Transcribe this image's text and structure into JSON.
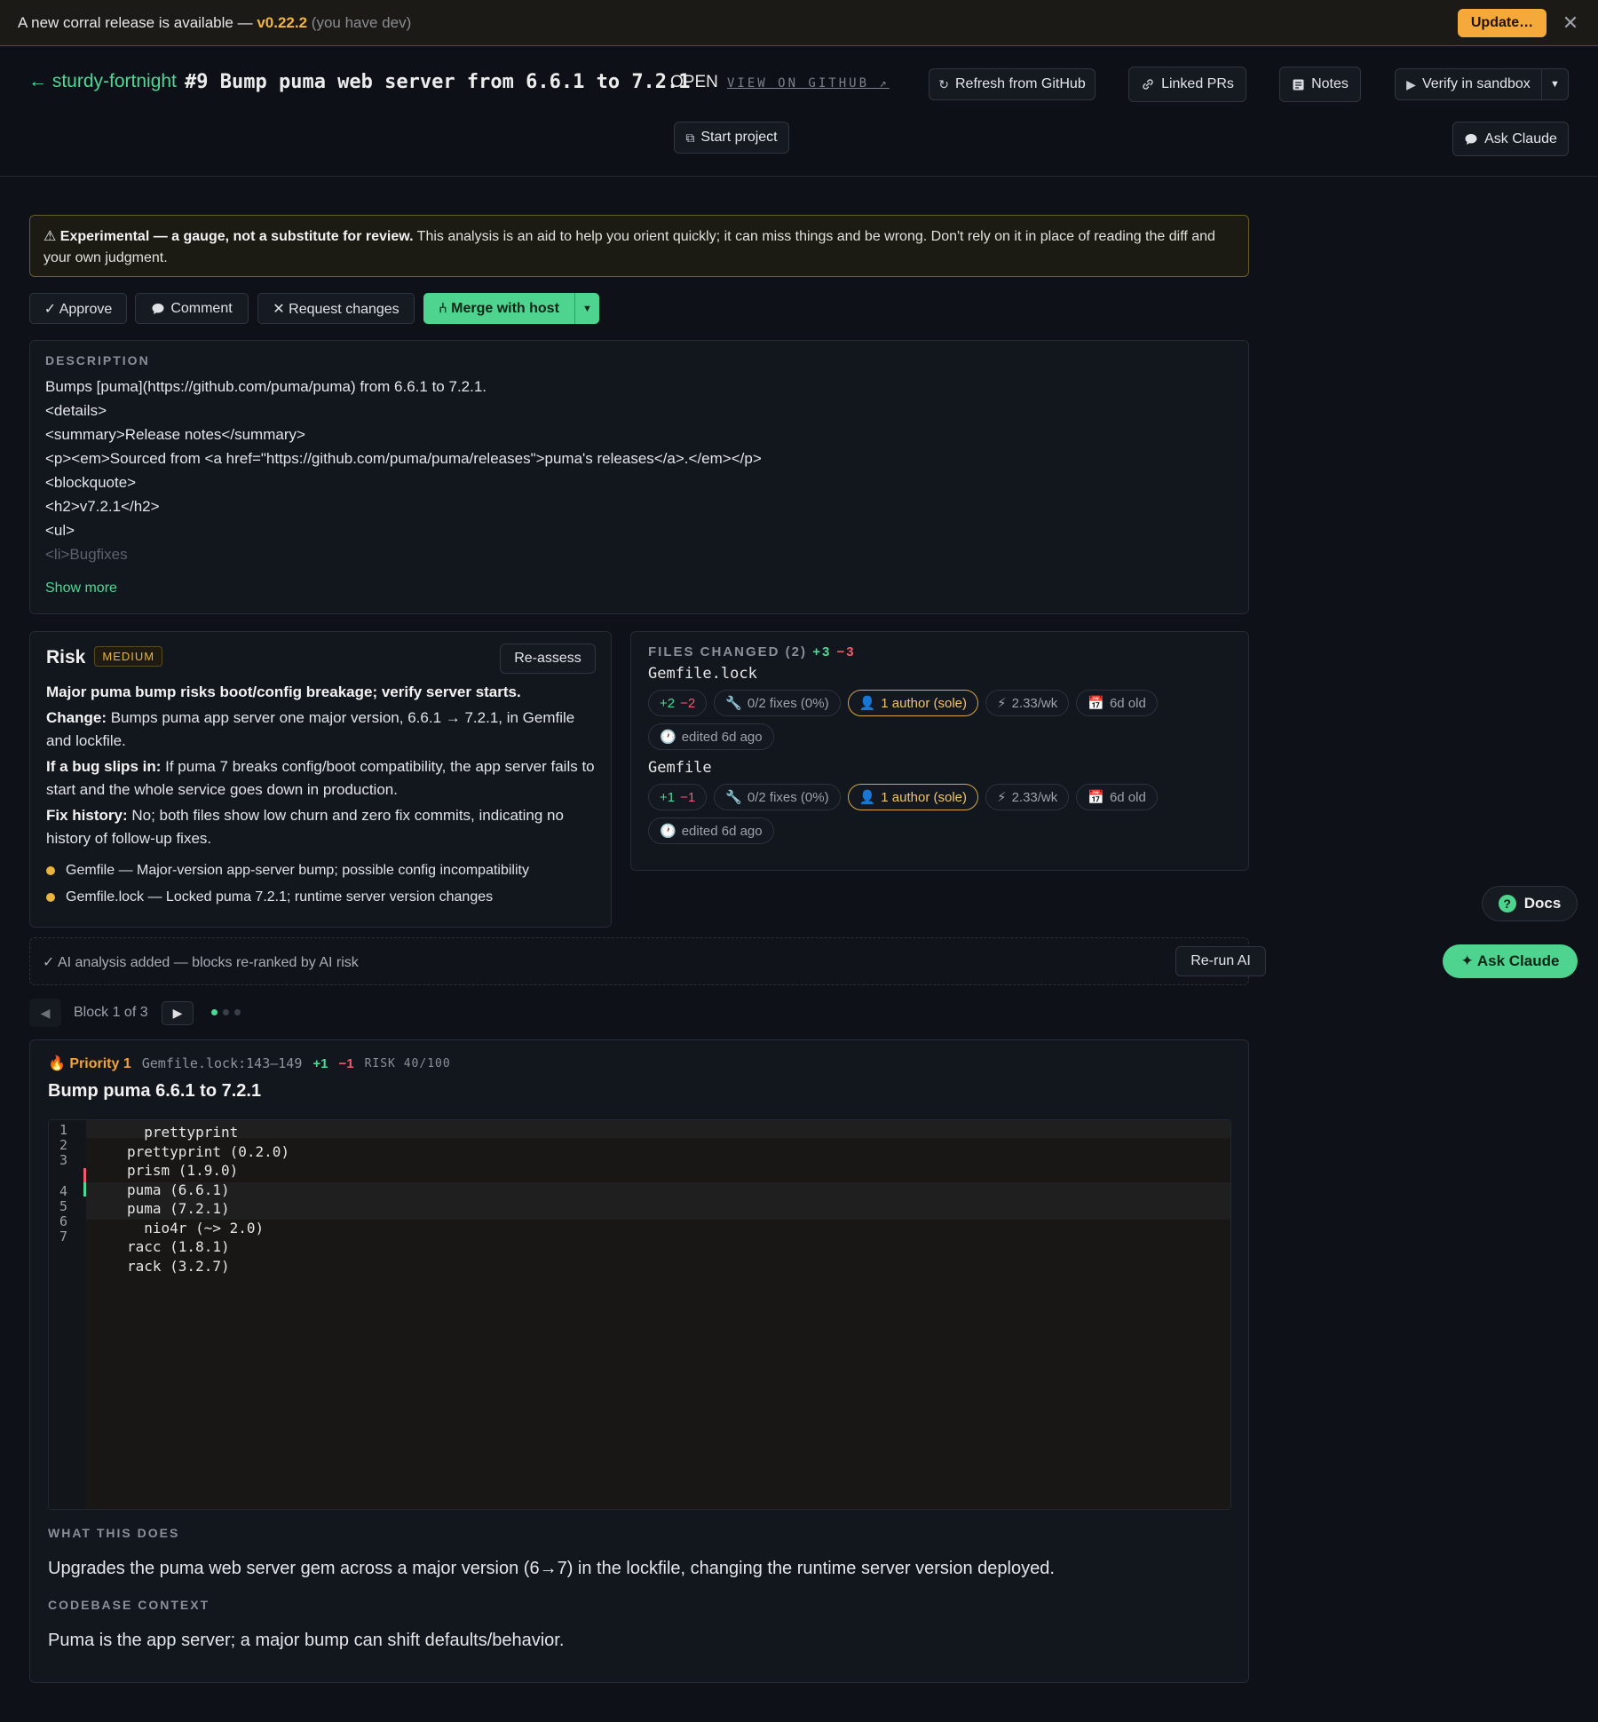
{
  "banner": {
    "message": "A new corral release is available —",
    "version": "v0.22.2",
    "have": "(you have dev)",
    "update_label": "Update…",
    "close_glyph": "✕"
  },
  "header": {
    "back_label": "← sturdy-fortnight",
    "pr_title": "#9 Bump puma web server from 6.6.1 to 7.2.1",
    "state": "OPEN",
    "view_on_github": "VIEW ON GITHUB ↗",
    "refresh_label": "Refresh from GitHub",
    "linked_prs_label": "Linked PRs",
    "notes_label": "Notes",
    "verify_label": "Verify in sandbox",
    "start_project_label": "Start project",
    "ask_claude_label": "Ask Claude"
  },
  "warning": {
    "bold": "⚠ Experimental — a gauge, not a substitute for review.",
    "text": " This analysis is an aid to help you orient quickly; it can miss things and be wrong. Don't rely on it in place of reading the diff and your own judgment."
  },
  "actions": {
    "approve": "✓ Approve",
    "comment": "Comment",
    "request_changes": "✕ Request changes",
    "merge": "⑃ Merge with host"
  },
  "description": {
    "label": "DESCRIPTION",
    "lines": [
      "Bumps [puma](https://github.com/puma/puma) from 6.6.1 to 7.2.1.",
      "<details>",
      "<summary>Release notes</summary>",
      "<p><em>Sourced from <a href=\"https://github.com/puma/puma/releases\">puma's releases</a>.</em></p>",
      "<blockquote>",
      "<h2>v7.2.1</h2>",
      "<ul>",
      "<li>Bugfixes"
    ],
    "show_more": "Show more"
  },
  "risk": {
    "title": "Risk",
    "level": "MEDIUM",
    "reassess_label": "Re-assess",
    "headline": "Major puma bump risks boot/config breakage; verify server starts.",
    "change_label": "Change:",
    "change_text": " Bumps puma app server one major version, 6.6.1 → 7.2.1, in Gemfile and lockfile.",
    "bug_label": "If a bug slips in:",
    "bug_text": " If puma 7 breaks config/boot compatibility, the app server fails to start and the whole service goes down in production.",
    "fix_label": "Fix history:",
    "fix_text": " No; both files show low churn and zero fix commits, indicating no history of follow-up fixes.",
    "items": [
      "Gemfile — Major-version app-server bump; possible config incompatibility",
      "Gemfile.lock — Locked puma 7.2.1; runtime server version changes"
    ],
    "accent_color": "#e8b43d"
  },
  "files": {
    "label": "FILES CHANGED (2)",
    "add_total": "+3",
    "del_total": "−3",
    "list": [
      {
        "name": "Gemfile.lock",
        "add": "+2",
        "del": "−2",
        "fixes": "0/2 fixes (0%)",
        "author": "1 author (sole)",
        "rate": "2.33/wk",
        "age": "6d old",
        "edited": "edited 6d ago"
      },
      {
        "name": "Gemfile",
        "add": "+1",
        "del": "−1",
        "fixes": "0/2 fixes (0%)",
        "author": "1 author (sole)",
        "rate": "2.33/wk",
        "age": "6d old",
        "edited": "edited 6d ago"
      }
    ]
  },
  "ai": {
    "status": "✓ AI analysis added — blocks re-ranked by AI risk",
    "rerun_label": "Re-run AI"
  },
  "nav": {
    "label": "Block 1 of 3",
    "current": 1,
    "total": 3
  },
  "block": {
    "priority": "🔥 Priority 1",
    "location": "Gemfile.lock:143–149",
    "add": "+1",
    "del": "−1",
    "risk": "RISK 40/100",
    "title": "Bump puma 6.6.1 to 7.2.1",
    "line_numbers": [
      "1",
      "2",
      "3",
      "4",
      "5",
      "6",
      "7"
    ],
    "code_lines": [
      "  prettyprint",
      "prettyprint (0.2.0)",
      "prism (1.9.0)",
      "puma (6.6.1)",
      "puma (7.2.1)",
      "  nio4r (~> 2.0)",
      "racc (1.8.1)",
      "rack (3.2.7)"
    ],
    "what_label": "WHAT THIS DOES",
    "what_text": "Upgrades the puma web server gem across a major version (6→7) in the lockfile, changing the runtime server version deployed.",
    "context_label": "CODEBASE CONTEXT",
    "context_text": "Puma is the app server; a major bump can shift defaults/behavior."
  },
  "floating": {
    "docs_label": "Docs",
    "ask_label": "✦ Ask Claude"
  },
  "colors": {
    "accent_green": "#4fd48f",
    "warn_orange": "#f5a93a",
    "add": "#4fd796",
    "del": "#ef5a6f"
  }
}
